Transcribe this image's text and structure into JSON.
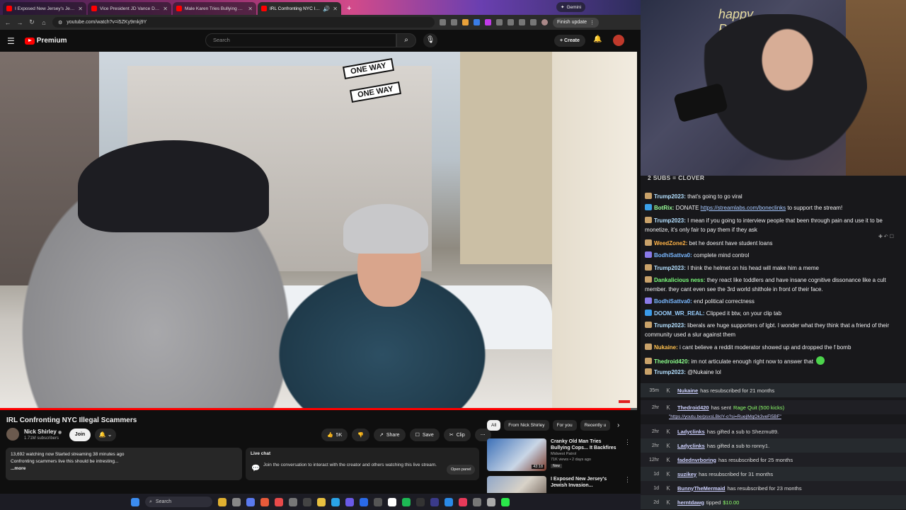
{
  "browser": {
    "tabs": [
      {
        "title": "I Exposed New Jersey's Jewish"
      },
      {
        "title": "Vice President JD Vance Deliv"
      },
      {
        "title": "Male Karen Tries Bullying Offic"
      },
      {
        "title": "IRL Confronting NYC Illega"
      }
    ],
    "new_tab": "+",
    "gemini": "Gemini",
    "url": "youtube.com/watch?v=i5ZKy9mkj9Y",
    "finish_update": "Finish update"
  },
  "youtube": {
    "logo": "Premium",
    "search_placeholder": "Search",
    "create": "Create",
    "video_title": "IRL Confronting NYC Illegal Scammers",
    "channel": "Nick Shirley",
    "subscribers": "1.71M subscribers",
    "join": "Join",
    "likes": "5K",
    "share": "Share",
    "save": "Save",
    "clip": "Clip",
    "description": {
      "line1": "13,692 watching now  Started streaming 38 minutes ago",
      "line2": "Confronting scammers live this should be intresting...",
      "more": "...more"
    },
    "live_chat": {
      "title": "Live chat",
      "text": "Join the conversation to interact with the creator and others watching this live stream.",
      "button": "Open panel"
    },
    "chips": [
      "All",
      "From Nick Shirley",
      "For you",
      "Recently u"
    ],
    "recommendations": [
      {
        "title": "Cranky Old Man Tries Bullying Cops... It Backfires",
        "channel": "Midwest Patrol",
        "meta": "71K views • 2 days ago",
        "badge": "New",
        "duration": "43:18"
      },
      {
        "title": "I Exposed New Jersey's Jewish Invasion...",
        "channel": "",
        "meta": "",
        "badge": "",
        "duration": ""
      }
    ],
    "video_progress": 0.99,
    "signs": [
      "ONE WAY",
      "ONE WAY"
    ]
  },
  "taskbar": {
    "search": "Search"
  },
  "stream": {
    "banner": "happy Patrick's",
    "goal": "2 SUBS = CLOVER",
    "chat": [
      {
        "user": "Trump2023:",
        "color": "#b4e0ff",
        "text": " that's going to go viral"
      },
      {
        "user": "BotRix:",
        "color": "#9aff9a",
        "text": " DONATE ",
        "link": "https://streamlabs.com/boneclinks",
        "after": " to support the stream!"
      },
      {
        "user": "Trump2023:",
        "color": "#b4e0ff",
        "text": " I mean if you going to interview people that been through pain and use it to be monetize, it's only fair to pay them if they ask"
      },
      {
        "user": "WeedZone2:",
        "color": "#ffb347",
        "text": " bet he doesnt have student loans"
      },
      {
        "user": "BodhiSattva0:",
        "color": "#7ab8ff",
        "text": " complete mind control"
      },
      {
        "user": "Trump2023:",
        "color": "#b4e0ff",
        "text": " I think the helmet on his head will make him a meme"
      },
      {
        "user": "Dankalicious ness:",
        "color": "#7dff7d",
        "text": " they react like toddlers and have insane cognitive dissonance like a cult member. they cant even see the 3rd world shithole in front of their face."
      },
      {
        "user": "BodhiSattva0:",
        "color": "#7ab8ff",
        "text": " end political correctness"
      },
      {
        "user": "DOOM_WR_REAL:",
        "color": "#9ad0ff",
        "text": " Clipped it btw, on your clip tab"
      },
      {
        "user": "Trump2023:",
        "color": "#b4e0ff",
        "text": " liberals are huge supporters of lgbt. I wonder what they think that a friend of their community used a slur against them"
      },
      {
        "user": "Nukaine:",
        "color": "#ffc04d",
        "text": " i cant believe a reddit moderator showed up and dropped the f bomb"
      },
      {
        "user": "Thedroid420:",
        "color": "#8cff8c",
        "text": " im not articulate enough right now to answer that"
      },
      {
        "user": "Trump2023:",
        "color": "#b4e0ff",
        "text": " @Nukaine lol"
      }
    ],
    "events": [
      {
        "time": "35m",
        "name": "Nukaine",
        "text": "has resubscribed for 21 months"
      },
      {
        "time": "2hr",
        "name": "Thedroid420",
        "text": "has sent",
        "gift": "Rage Quit (500 kicks)"
      },
      {
        "time": "",
        "name": "",
        "text": "\"https://youtu.be/psxsLBkIY-o?si=RuejlMqOk3veFl5BF\""
      },
      {
        "time": "2hr",
        "name": "Ladyclinks",
        "text": "has gifted a sub to Shezmu89."
      },
      {
        "time": "2hr",
        "name": "Ladyclinks",
        "text": "has gifted a sub to ronny1."
      },
      {
        "time": "12hr",
        "name": "fadednvrboring",
        "text": "has resubscribed for 25 months"
      },
      {
        "time": "1d",
        "name": "suzikey",
        "text": "has resubscribed for 31 months"
      },
      {
        "time": "1d",
        "name": "BunnyTheMermaid",
        "text": "has resubscribed for 23 months"
      },
      {
        "time": "2d",
        "name": "herntdawg",
        "text": "tipped",
        "gift": "$10.00"
      }
    ]
  }
}
